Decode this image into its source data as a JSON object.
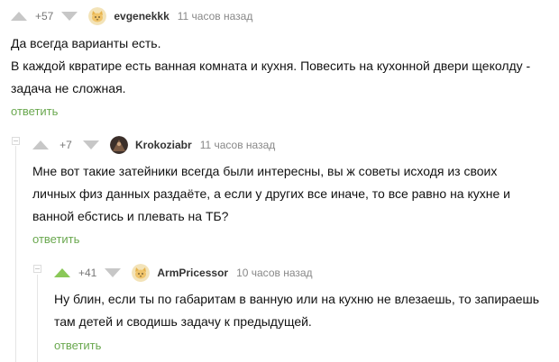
{
  "colors": {
    "reply_link": "#6aa84f",
    "vote_inactive": "#c7c7c7",
    "vote_active_upvote": "#8ac858",
    "thread_line": "#e5e5e5"
  },
  "comments": [
    {
      "rating": "+57",
      "author": "evgenekkk",
      "time": "11 часов назад",
      "avatar_icon": "cat-avatar",
      "upvoted": false,
      "text": [
        "Да всегда варианты есть.",
        "В каждой квратире есть ванная комната и кухня. Повесить на кухонной двери щеколду -",
        "задача не сложная."
      ],
      "reply_label": "ответить"
    },
    {
      "rating": "+7",
      "author": "Krokoziabr",
      "time": "11 часов назад",
      "avatar_icon": "dark-photo-avatar",
      "upvoted": false,
      "text": [
        "Мне вот такие затейники всегда были интересны, вы ж советы исходя из своих",
        "личных физ данных раздаёте, а если у других все иначе, то все равно на кухне и",
        "ванной ебстись и плевать на ТБ?"
      ],
      "reply_label": "ответить"
    },
    {
      "rating": "+41",
      "author": "ArmPricessor",
      "time": "10 часов назад",
      "avatar_icon": "cat-avatar",
      "upvoted": true,
      "text": [
        "Ну блин, если ты по габаритам в ванную или на кухню не влезаешь, то запираешь",
        "там детей и сводишь задачу к предыдущей."
      ],
      "reply_label": "ответить"
    }
  ]
}
